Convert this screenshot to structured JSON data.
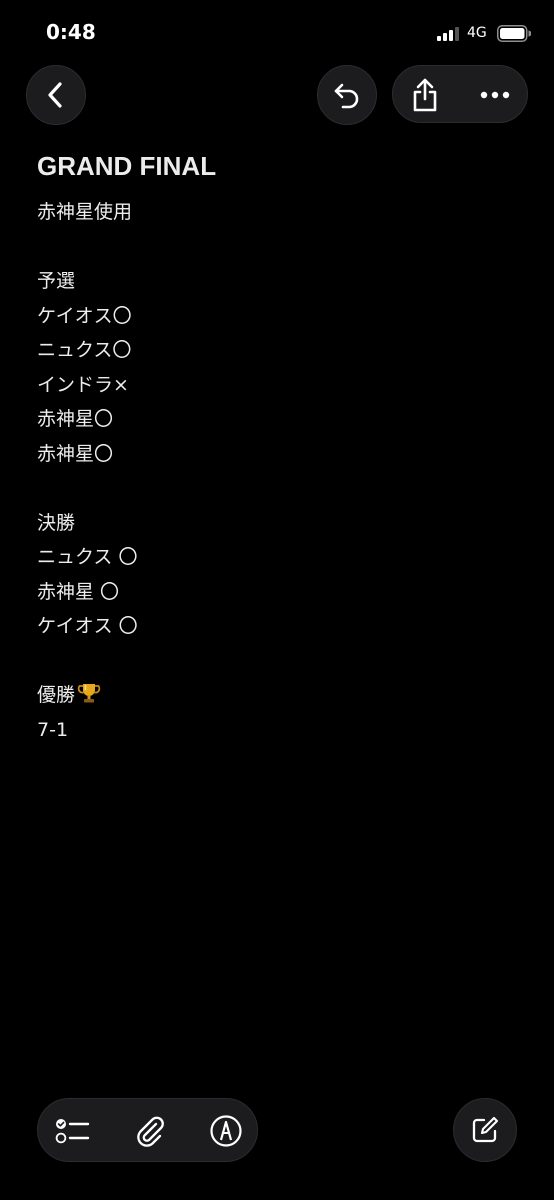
{
  "status_bar": {
    "time": "0:48",
    "network": "4G",
    "signal_icon": "cellular-signal-icon",
    "battery_icon": "battery-icon"
  },
  "toolbar": {
    "back_icon": "chevron-left-icon",
    "undo_icon": "undo-icon",
    "share_icon": "share-icon",
    "more_icon": "ellipsis-icon"
  },
  "note": {
    "title": "GRAND FINAL",
    "lines": [
      "赤神星使用",
      "",
      "予選",
      "ケイオス〇",
      "ニュクス〇",
      "インドラ×",
      "赤神星〇",
      "赤神星〇",
      "",
      "決勝",
      "ニュクス 〇",
      "赤神星 〇",
      "ケイオス 〇",
      "",
      "優勝",
      "7-1"
    ],
    "trophy_icon": "trophy-icon"
  },
  "bottom_toolbar": {
    "checklist_icon": "checklist-icon",
    "attach_icon": "paperclip-icon",
    "markup_icon": "markup-pen-icon",
    "compose_icon": "compose-icon"
  },
  "colors": {
    "background": "#000000",
    "button_bg": "#1c1c1e",
    "text": "#ededed"
  }
}
